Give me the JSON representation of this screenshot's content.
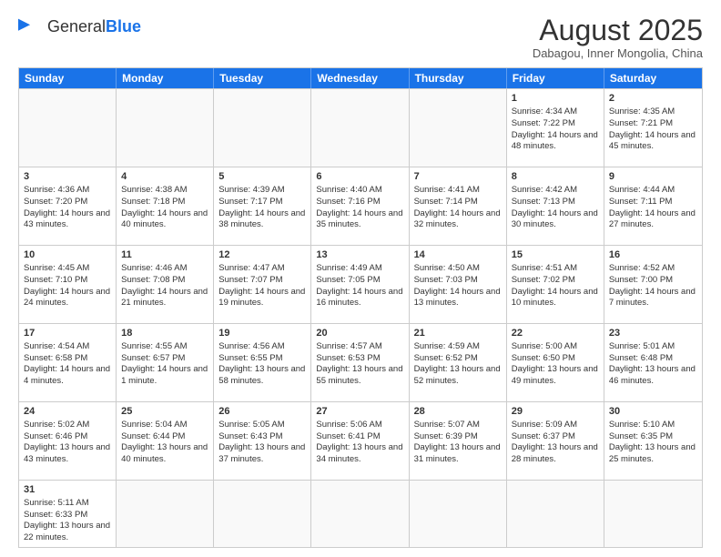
{
  "logo": {
    "text_general": "General",
    "text_blue": "Blue"
  },
  "title": "August 2025",
  "location": "Dabagou, Inner Mongolia, China",
  "header_days": [
    "Sunday",
    "Monday",
    "Tuesday",
    "Wednesday",
    "Thursday",
    "Friday",
    "Saturday"
  ],
  "rows": [
    [
      {
        "day": "",
        "content": "",
        "empty": true
      },
      {
        "day": "",
        "content": "",
        "empty": true
      },
      {
        "day": "",
        "content": "",
        "empty": true
      },
      {
        "day": "",
        "content": "",
        "empty": true
      },
      {
        "day": "",
        "content": "",
        "empty": true
      },
      {
        "day": "1",
        "content": "Sunrise: 4:34 AM\nSunset: 7:22 PM\nDaylight: 14 hours and 48 minutes.",
        "empty": false
      },
      {
        "day": "2",
        "content": "Sunrise: 4:35 AM\nSunset: 7:21 PM\nDaylight: 14 hours and 45 minutes.",
        "empty": false
      }
    ],
    [
      {
        "day": "3",
        "content": "Sunrise: 4:36 AM\nSunset: 7:20 PM\nDaylight: 14 hours and 43 minutes.",
        "empty": false
      },
      {
        "day": "4",
        "content": "Sunrise: 4:38 AM\nSunset: 7:18 PM\nDaylight: 14 hours and 40 minutes.",
        "empty": false
      },
      {
        "day": "5",
        "content": "Sunrise: 4:39 AM\nSunset: 7:17 PM\nDaylight: 14 hours and 38 minutes.",
        "empty": false
      },
      {
        "day": "6",
        "content": "Sunrise: 4:40 AM\nSunset: 7:16 PM\nDaylight: 14 hours and 35 minutes.",
        "empty": false
      },
      {
        "day": "7",
        "content": "Sunrise: 4:41 AM\nSunset: 7:14 PM\nDaylight: 14 hours and 32 minutes.",
        "empty": false
      },
      {
        "day": "8",
        "content": "Sunrise: 4:42 AM\nSunset: 7:13 PM\nDaylight: 14 hours and 30 minutes.",
        "empty": false
      },
      {
        "day": "9",
        "content": "Sunrise: 4:44 AM\nSunset: 7:11 PM\nDaylight: 14 hours and 27 minutes.",
        "empty": false
      }
    ],
    [
      {
        "day": "10",
        "content": "Sunrise: 4:45 AM\nSunset: 7:10 PM\nDaylight: 14 hours and 24 minutes.",
        "empty": false
      },
      {
        "day": "11",
        "content": "Sunrise: 4:46 AM\nSunset: 7:08 PM\nDaylight: 14 hours and 21 minutes.",
        "empty": false
      },
      {
        "day": "12",
        "content": "Sunrise: 4:47 AM\nSunset: 7:07 PM\nDaylight: 14 hours and 19 minutes.",
        "empty": false
      },
      {
        "day": "13",
        "content": "Sunrise: 4:49 AM\nSunset: 7:05 PM\nDaylight: 14 hours and 16 minutes.",
        "empty": false
      },
      {
        "day": "14",
        "content": "Sunrise: 4:50 AM\nSunset: 7:03 PM\nDaylight: 14 hours and 13 minutes.",
        "empty": false
      },
      {
        "day": "15",
        "content": "Sunrise: 4:51 AM\nSunset: 7:02 PM\nDaylight: 14 hours and 10 minutes.",
        "empty": false
      },
      {
        "day": "16",
        "content": "Sunrise: 4:52 AM\nSunset: 7:00 PM\nDaylight: 14 hours and 7 minutes.",
        "empty": false
      }
    ],
    [
      {
        "day": "17",
        "content": "Sunrise: 4:54 AM\nSunset: 6:58 PM\nDaylight: 14 hours and 4 minutes.",
        "empty": false
      },
      {
        "day": "18",
        "content": "Sunrise: 4:55 AM\nSunset: 6:57 PM\nDaylight: 14 hours and 1 minute.",
        "empty": false
      },
      {
        "day": "19",
        "content": "Sunrise: 4:56 AM\nSunset: 6:55 PM\nDaylight: 13 hours and 58 minutes.",
        "empty": false
      },
      {
        "day": "20",
        "content": "Sunrise: 4:57 AM\nSunset: 6:53 PM\nDaylight: 13 hours and 55 minutes.",
        "empty": false
      },
      {
        "day": "21",
        "content": "Sunrise: 4:59 AM\nSunset: 6:52 PM\nDaylight: 13 hours and 52 minutes.",
        "empty": false
      },
      {
        "day": "22",
        "content": "Sunrise: 5:00 AM\nSunset: 6:50 PM\nDaylight: 13 hours and 49 minutes.",
        "empty": false
      },
      {
        "day": "23",
        "content": "Sunrise: 5:01 AM\nSunset: 6:48 PM\nDaylight: 13 hours and 46 minutes.",
        "empty": false
      }
    ],
    [
      {
        "day": "24",
        "content": "Sunrise: 5:02 AM\nSunset: 6:46 PM\nDaylight: 13 hours and 43 minutes.",
        "empty": false
      },
      {
        "day": "25",
        "content": "Sunrise: 5:04 AM\nSunset: 6:44 PM\nDaylight: 13 hours and 40 minutes.",
        "empty": false
      },
      {
        "day": "26",
        "content": "Sunrise: 5:05 AM\nSunset: 6:43 PM\nDaylight: 13 hours and 37 minutes.",
        "empty": false
      },
      {
        "day": "27",
        "content": "Sunrise: 5:06 AM\nSunset: 6:41 PM\nDaylight: 13 hours and 34 minutes.",
        "empty": false
      },
      {
        "day": "28",
        "content": "Sunrise: 5:07 AM\nSunset: 6:39 PM\nDaylight: 13 hours and 31 minutes.",
        "empty": false
      },
      {
        "day": "29",
        "content": "Sunrise: 5:09 AM\nSunset: 6:37 PM\nDaylight: 13 hours and 28 minutes.",
        "empty": false
      },
      {
        "day": "30",
        "content": "Sunrise: 5:10 AM\nSunset: 6:35 PM\nDaylight: 13 hours and 25 minutes.",
        "empty": false
      }
    ],
    [
      {
        "day": "31",
        "content": "Sunrise: 5:11 AM\nSunset: 6:33 PM\nDaylight: 13 hours and 22 minutes.",
        "empty": false
      },
      {
        "day": "",
        "content": "",
        "empty": true
      },
      {
        "day": "",
        "content": "",
        "empty": true
      },
      {
        "day": "",
        "content": "",
        "empty": true
      },
      {
        "day": "",
        "content": "",
        "empty": true
      },
      {
        "day": "",
        "content": "",
        "empty": true
      },
      {
        "day": "",
        "content": "",
        "empty": true
      }
    ]
  ]
}
